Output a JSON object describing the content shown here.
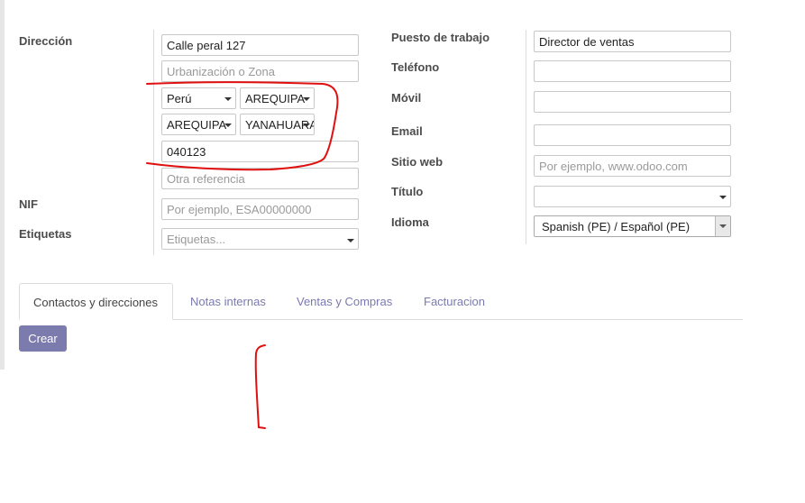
{
  "labels": {
    "direccion": "Dirección",
    "nif": "NIF",
    "etiquetas": "Etiquetas",
    "puesto": "Puesto de trabajo",
    "telefono": "Teléfono",
    "movil": "Móvil",
    "email": "Email",
    "sitio_web": "Sitio web",
    "titulo": "Título",
    "idioma": "Idioma"
  },
  "address": {
    "street": "Calle peral 127",
    "street2_placeholder": "Urbanización o Zona",
    "country": "Perú",
    "state": "AREQUIPA",
    "province": "AREQUIPA",
    "district": "YANAHUARA",
    "zip": "040123",
    "reference_placeholder": "Otra referencia"
  },
  "nif_placeholder": "Por ejemplo, ESA00000000",
  "tags_placeholder": "Etiquetas...",
  "job": {
    "position": "Director de ventas",
    "phone": "",
    "mobile": "",
    "email": "",
    "website_placeholder": "Por ejemplo, www.odoo.com",
    "title": "",
    "language": "Spanish (PE) / Español (PE)"
  },
  "tabs": [
    "Contactos y direcciones",
    "Notas internas",
    "Ventas y Compras",
    "Facturacion"
  ],
  "create_button": "Crear",
  "colors": {
    "annotation": "#e01010",
    "button": "#7c7bad",
    "tab_link": "#7a7ab0"
  }
}
